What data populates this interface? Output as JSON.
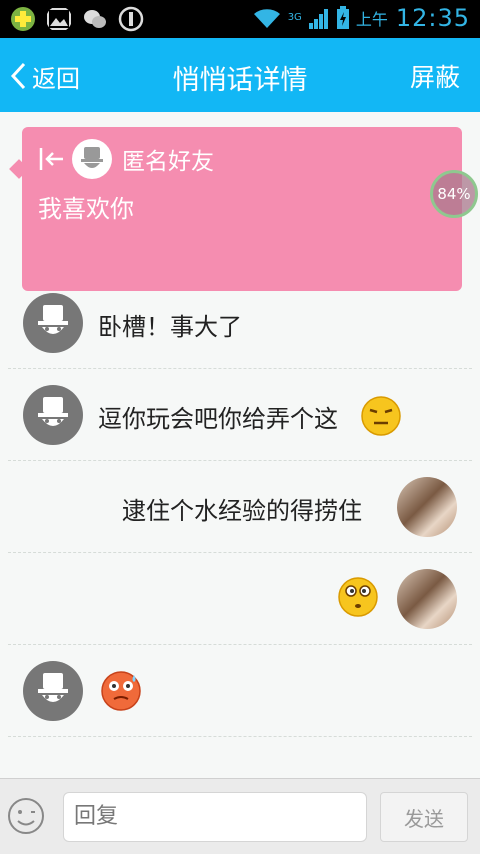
{
  "status_bar": {
    "time": "12:35",
    "ampm": "上午",
    "network": "3G"
  },
  "header": {
    "back_label": "返回",
    "title": "悄悄话详情",
    "block_label": "屏蔽"
  },
  "whisper_card": {
    "sender": "匿名好友",
    "message": "我喜欢你",
    "badge": "84%"
  },
  "messages": [
    {
      "side": "left",
      "sender": "anonymous",
      "text": "卧槽！事大了"
    },
    {
      "side": "left",
      "sender": "anonymous",
      "text": "逗你玩会吧你给弄个这",
      "emoji": "smirk-emoji"
    },
    {
      "side": "right",
      "sender": "me",
      "text": "逮住个水经验的得捞住"
    },
    {
      "side": "right",
      "sender": "me",
      "text": "",
      "emoji": "dizzy-emoji"
    },
    {
      "side": "left",
      "sender": "anonymous",
      "text": "",
      "emoji": "sweat-emoji"
    }
  ],
  "composer": {
    "placeholder": "回复",
    "send_label": "发送"
  }
}
